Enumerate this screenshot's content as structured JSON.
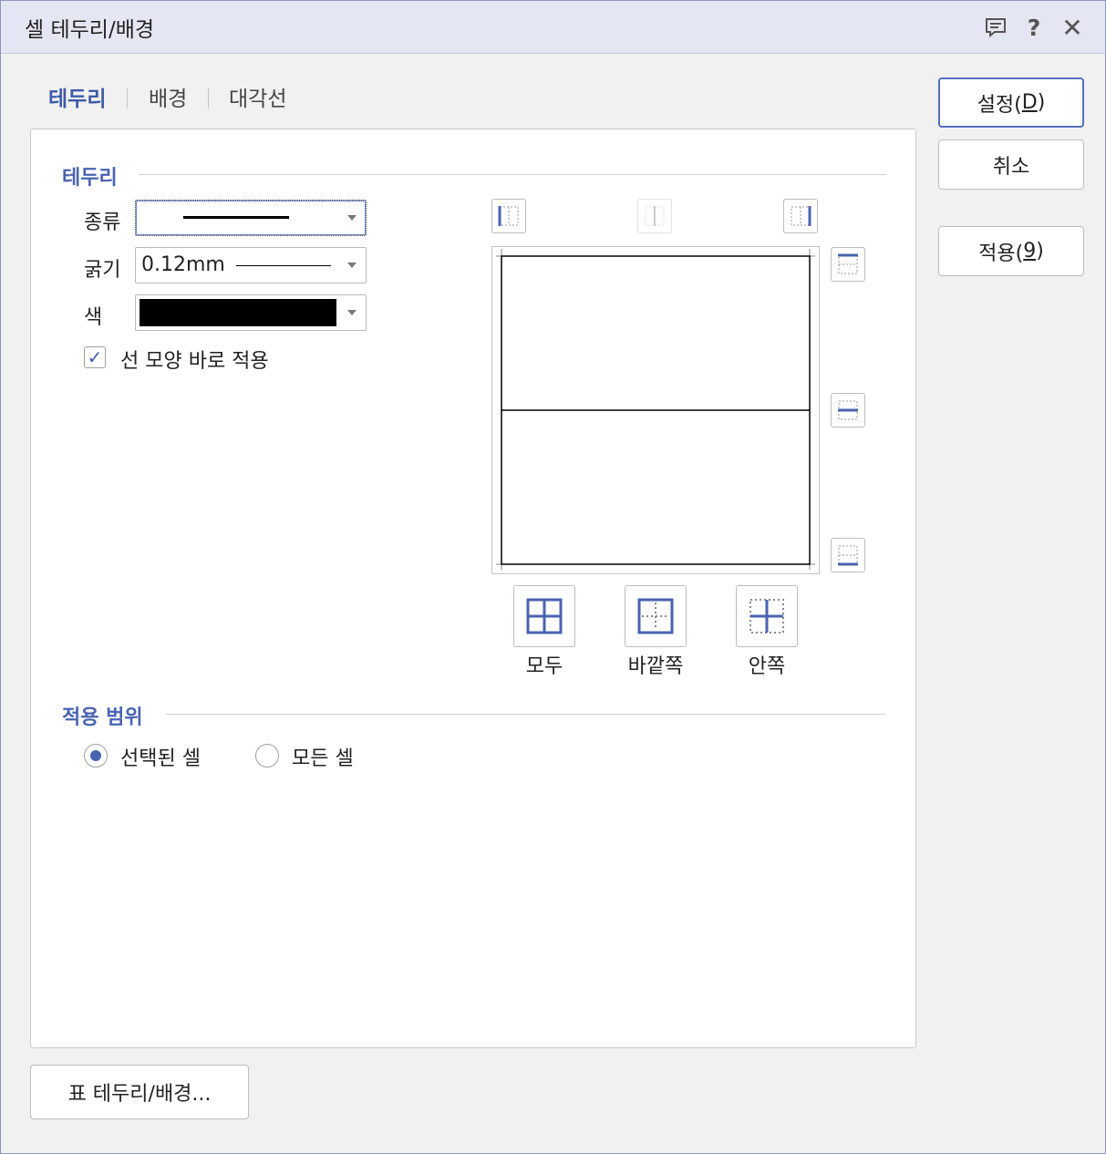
{
  "dialog": {
    "title": "셀 테두리/배경",
    "controls": {
      "comment_icon": "comment-icon",
      "help": "?",
      "close": "✕"
    }
  },
  "tabs": [
    {
      "label": "테두리",
      "active": true
    },
    {
      "label": "배경",
      "active": false
    },
    {
      "label": "대각선",
      "active": false
    }
  ],
  "border_section": {
    "title": "테두리",
    "type_label": "종류",
    "type_value": "solid-line",
    "width_label": "굵기",
    "width_value": "0.12mm",
    "color_label": "색",
    "color_value": "#000000",
    "apply_immediately": {
      "label": "선 모양 바로 적용",
      "checked": true
    }
  },
  "presets": {
    "all": "모두",
    "outside": "바깥쪽",
    "inside": "안쪽"
  },
  "scope_section": {
    "title": "적용 범위",
    "options": [
      {
        "label": "선택된 셀",
        "selected": true
      },
      {
        "label": "모든 셀",
        "selected": false
      }
    ]
  },
  "buttons": {
    "set_prefix": "설정(",
    "set_key": "D",
    "set_suffix": ")",
    "cancel": "취소",
    "apply_prefix": "적용(",
    "apply_key": "9",
    "apply_suffix": ")",
    "table_border": "표 테두리/배경..."
  },
  "colors": {
    "accent": "#4a63b0",
    "title_bar": "#e4e7f3"
  }
}
